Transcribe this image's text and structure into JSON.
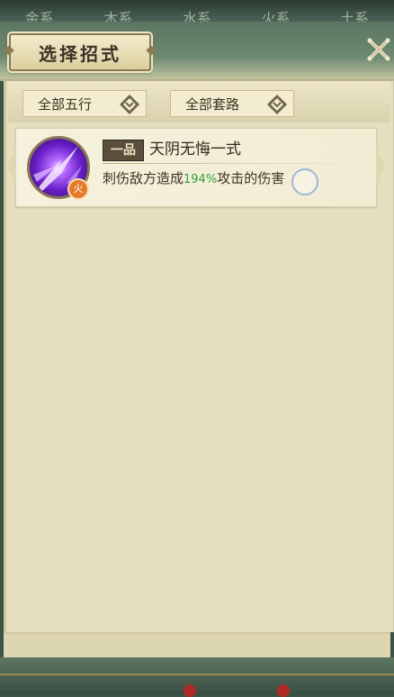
{
  "top_tabs": [
    "金系",
    "木系",
    "水系",
    "火系",
    "土系"
  ],
  "window": {
    "title": "选择招式",
    "close_icon": "close-x-icon"
  },
  "filters": [
    {
      "label": "全部五行",
      "icon": "diamond-dropdown-icon"
    },
    {
      "label": "全部套路",
      "icon": "diamond-dropdown-icon"
    }
  ],
  "skills": [
    {
      "grade": "一品",
      "name": "天阴无悔一式",
      "element": "火",
      "element_color": "#e6792b",
      "desc_prefix": "刺伤敌方造成",
      "desc_percent": "194%",
      "desc_suffix": "攻击的伤害",
      "percent_color": "#2fa23a",
      "icon": "purple-slash-skill-icon"
    }
  ],
  "colors": {
    "header_green": "#5a7560",
    "panel_bg": "#e4dfbf",
    "card_bg": "#f6f1dc"
  }
}
